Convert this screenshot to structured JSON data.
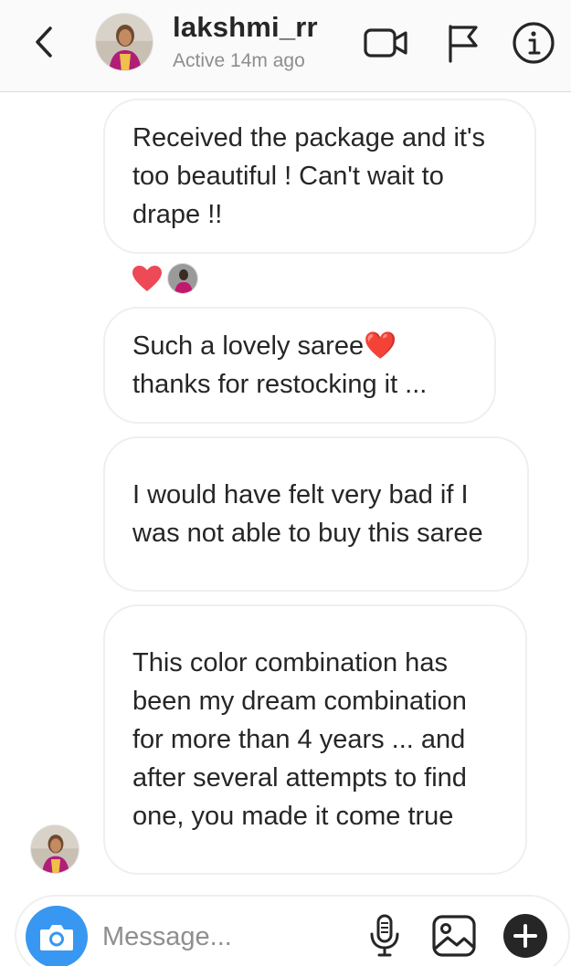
{
  "header": {
    "username": "lakshmi_rr",
    "status": "Active 14m ago",
    "icons": [
      "back-chevron-icon",
      "video-call-icon",
      "flag-icon",
      "info-icon"
    ]
  },
  "messages": [
    {
      "text": "Received the package and it's too beautiful ! Can't wait to drape !!"
    },
    {
      "text": "Such a lovely saree❤️ thanks for restocking it ..."
    },
    {
      "text": "I would have felt very bad if I was not able to buy this saree"
    },
    {
      "text": "This color combination has been my dream combination for more than 4 years ... and after several attempts to find one, you made it come true"
    }
  ],
  "reaction": {
    "emoji": "heart-icon",
    "color": "#ed4956"
  },
  "composer": {
    "placeholder": "Message...",
    "icons": [
      "camera-icon",
      "microphone-icon",
      "gallery-icon",
      "plus-icon"
    ]
  },
  "colors": {
    "accent": "#3897f0",
    "heart": "#ed4956",
    "text": "#262626",
    "muted": "#8e8e8e",
    "border": "#efefef"
  }
}
